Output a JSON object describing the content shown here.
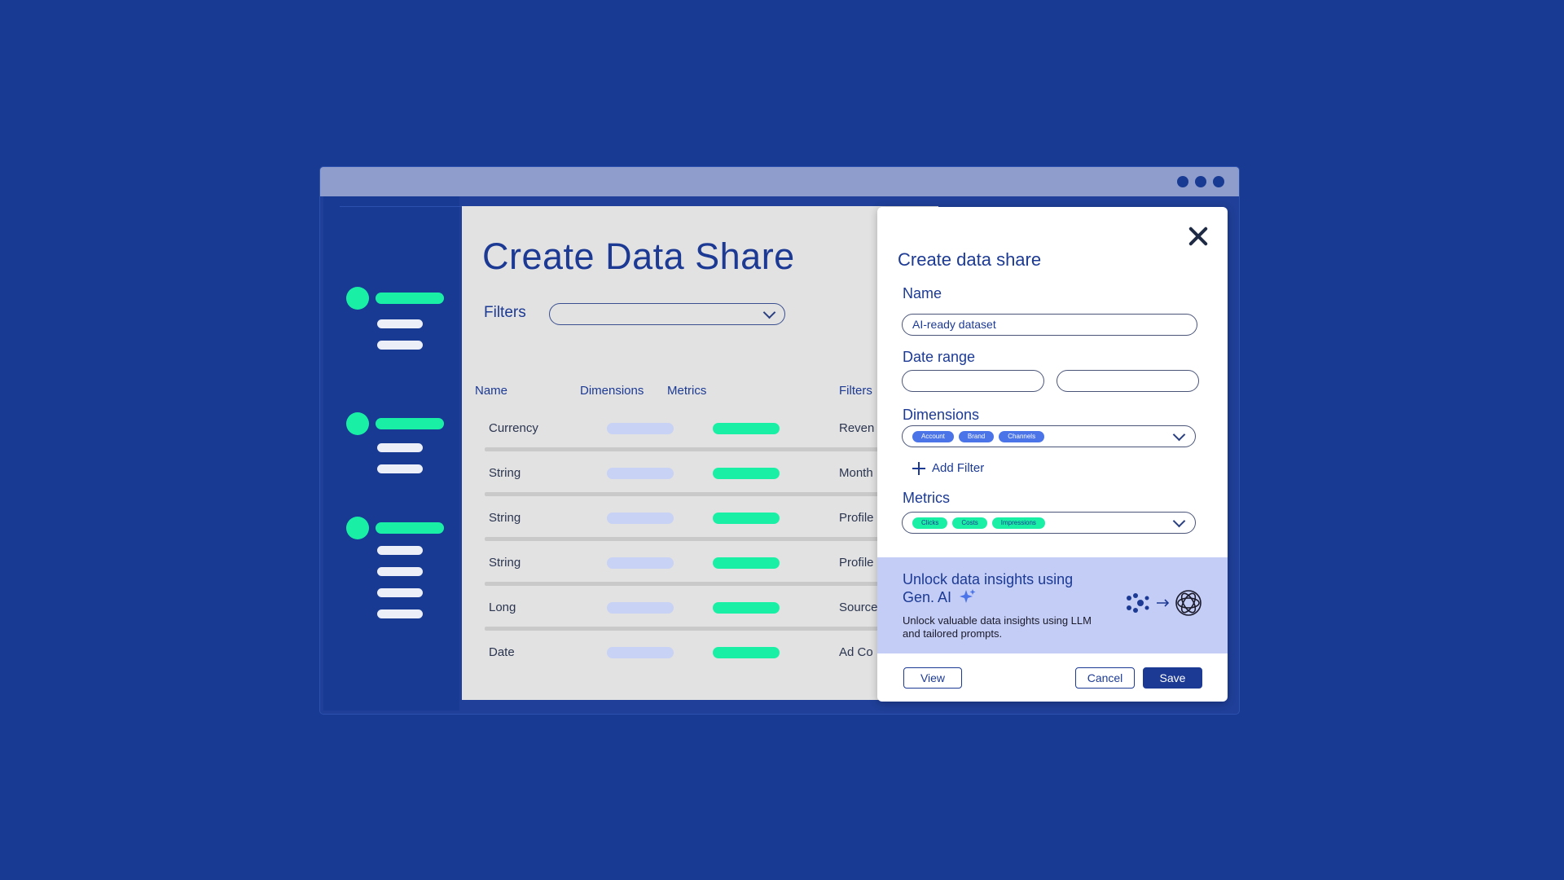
{
  "colors": {
    "background": "#183a93",
    "accent_green": "#19f0a6",
    "accent_blue": "#4a74e8",
    "title_blue": "#1c3a94",
    "ai_panel": "#c4cdf6"
  },
  "main": {
    "title": "Create Data Share",
    "filters_label": "Filters",
    "columns": [
      "Name",
      "Dimensions",
      "Metrics",
      "Filters"
    ],
    "rows": [
      {
        "name": "Currency",
        "filter": "Reven"
      },
      {
        "name": "String",
        "filter": "Month"
      },
      {
        "name": "String",
        "filter": "Profile"
      },
      {
        "name": "String",
        "filter": "Profile"
      },
      {
        "name": "Long",
        "filter": "Source"
      },
      {
        "name": "Date",
        "filter": "Ad Co"
      }
    ]
  },
  "modal": {
    "title": "Create data share",
    "name_label": "Name",
    "name_value": "AI-ready dataset",
    "date_range_label": "Date range",
    "dimensions_label": "Dimensions",
    "dimensions": [
      "Account",
      "Brand",
      "Channels"
    ],
    "add_filter": "Add Filter",
    "metrics_label": "Metrics",
    "metrics": [
      "Clicks",
      "Costs",
      "Impressions"
    ],
    "ai": {
      "title": "Unlock data insights using Gen. AI",
      "description": "Unlock valuable data insights using LLM and tailored prompts.",
      "icons": [
        "sparkle-icon",
        "brand-logo-icon",
        "arrow-right-icon",
        "openai-logo-icon"
      ]
    },
    "buttons": {
      "view": "View",
      "cancel": "Cancel",
      "save": "Save"
    }
  }
}
